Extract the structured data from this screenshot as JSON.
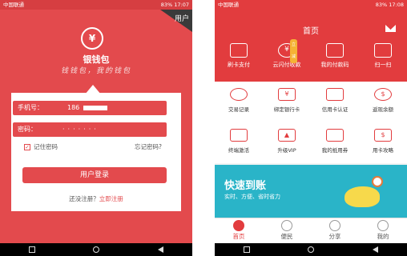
{
  "left_screen": {
    "status_bar": {
      "carrier": "中国联通",
      "battery": "83%",
      "time": "17:07"
    },
    "user_corner_label": "用户",
    "logo": {
      "symbol": "¥",
      "title": "银钱包",
      "slogan": "钱钱包，我的钱包"
    },
    "form": {
      "phone_label": "手机号：",
      "phone_value": "186",
      "password_label": "密码：",
      "password_mask": "·······",
      "remember_label": "记住密码",
      "remember_checked": true,
      "forgot_label": "忘记密码?",
      "login_button": "用户登录",
      "register_prompt": "还没注册？",
      "register_link": "立即注册"
    }
  },
  "right_screen": {
    "status_bar": {
      "carrier": "中国联通",
      "battery": "83%",
      "time": "17:08"
    },
    "header_title": "首页",
    "top_actions": [
      {
        "label": "刷卡支付",
        "icon": "card-payment-icon"
      },
      {
        "label": "云闪付收款",
        "icon": "yuan-receive-icon",
        "badge": "立减"
      },
      {
        "label": "我的付款码",
        "icon": "payment-code-icon"
      },
      {
        "label": "扫一扫",
        "icon": "scan-icon"
      }
    ],
    "grid": [
      {
        "label": "交易记录",
        "icon": "transaction-record-icon"
      },
      {
        "label": "绑定银行卡",
        "icon": "bind-card-icon"
      },
      {
        "label": "信用卡认证",
        "icon": "credit-card-icon"
      },
      {
        "label": "返现余额",
        "icon": "cashback-icon"
      },
      {
        "label": "终端激活",
        "icon": "terminal-activate-icon"
      },
      {
        "label": "升级VIP",
        "icon": "vip-upgrade-icon"
      },
      {
        "label": "我的抵用券",
        "icon": "coupon-icon"
      },
      {
        "label": "用卡攻略",
        "icon": "card-guide-icon"
      }
    ],
    "banner": {
      "title": "快速到账",
      "subtitle": "实时、方便、省时省力"
    },
    "tabs": [
      {
        "label": "首页",
        "active": true
      },
      {
        "label": "便民",
        "active": false
      },
      {
        "label": "分享",
        "active": false
      },
      {
        "label": "我的",
        "active": false
      }
    ]
  },
  "colors": {
    "brand_red": "#e34a4d",
    "banner_teal": "#2ab4c8"
  }
}
